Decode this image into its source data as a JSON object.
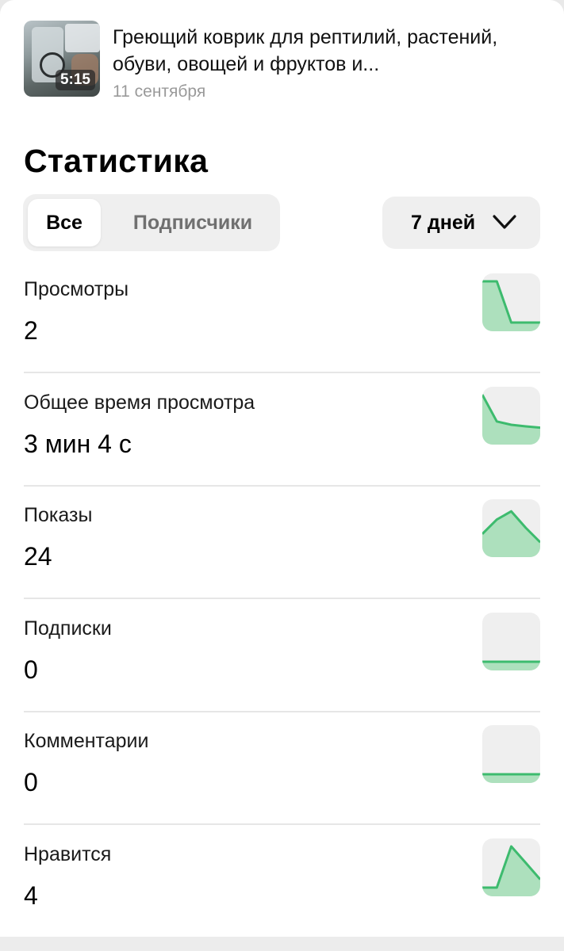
{
  "video": {
    "title": "Греющий коврик для рептилий, растений, обуви, овощей и фруктов и...",
    "duration": "5:15",
    "date": "11 сентября"
  },
  "stats_title": "Статистика",
  "audience_tabs": [
    {
      "label": "Все",
      "selected": true
    },
    {
      "label": "Подписчики",
      "selected": false
    }
  ],
  "period": {
    "label": "7 дней"
  },
  "colors": {
    "accent_line": "#3dbb6e",
    "accent_fill": "#ade0bd",
    "tile_bg": "#efefef"
  },
  "metrics": [
    {
      "label": "Просмотры",
      "value": "2",
      "trend": [
        1,
        1,
        0,
        0,
        0
      ]
    },
    {
      "label": "Общее время просмотра",
      "value": "3 мин 4 с",
      "trend": [
        1,
        0.35,
        0.27,
        0.23,
        0.2
      ]
    },
    {
      "label": "Показы",
      "value": "24",
      "trend": [
        0.35,
        0.7,
        0.9,
        0.5,
        0.15
      ]
    },
    {
      "label": "Подписки",
      "value": "0",
      "trend": [
        0,
        0,
        0,
        0,
        0
      ]
    },
    {
      "label": "Комментарии",
      "value": "0",
      "trend": [
        0,
        0,
        0,
        0,
        0
      ]
    },
    {
      "label": "Нравится",
      "value": "4",
      "trend": [
        0,
        0,
        1,
        0.6,
        0.2
      ]
    }
  ]
}
